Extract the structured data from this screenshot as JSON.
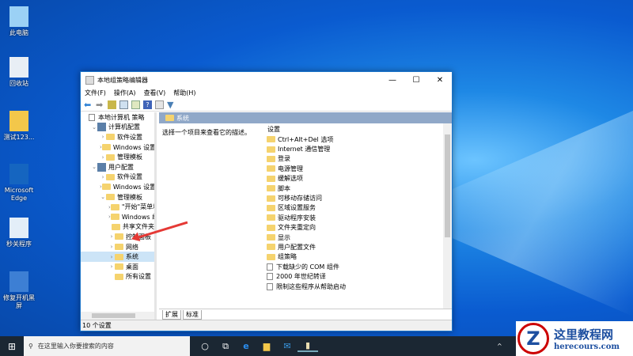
{
  "desktop": {
    "icons": [
      "此电脑",
      "回收站",
      "测试123...",
      "Microsoft Edge",
      "秒关程序",
      "修复开机黑屏"
    ]
  },
  "window": {
    "title": "本地组策略编辑器",
    "controls": [
      "—",
      "☐",
      "✕"
    ],
    "menu": [
      "文件(F)",
      "操作(A)",
      "查看(V)",
      "帮助(H)"
    ],
    "tree": [
      {
        "label": "本地计算机 策略",
        "level": 0,
        "chev": ""
      },
      {
        "label": "计算机配置",
        "level": 1,
        "chev": "⌄"
      },
      {
        "label": "软件设置",
        "level": 2,
        "chev": "›"
      },
      {
        "label": "Windows 设置",
        "level": 2,
        "chev": "›"
      },
      {
        "label": "管理模板",
        "level": 2,
        "chev": "›"
      },
      {
        "label": "用户配置",
        "level": 1,
        "chev": "⌄"
      },
      {
        "label": "软件设置",
        "level": 2,
        "chev": "›"
      },
      {
        "label": "Windows 设置",
        "level": 2,
        "chev": "›"
      },
      {
        "label": "管理模板",
        "level": 2,
        "chev": "⌄"
      },
      {
        "label": "\"开始\"菜单和",
        "level": 3,
        "chev": "›"
      },
      {
        "label": "Windows 组",
        "level": 3,
        "chev": "›"
      },
      {
        "label": "共享文件夹",
        "level": 3,
        "chev": ""
      },
      {
        "label": "控制面板",
        "level": 3,
        "chev": "›"
      },
      {
        "label": "网络",
        "level": 3,
        "chev": "›"
      },
      {
        "label": "系统",
        "level": 3,
        "chev": "›",
        "selected": true
      },
      {
        "label": "桌面",
        "level": 3,
        "chev": "›"
      },
      {
        "label": "所有设置",
        "level": 3,
        "chev": ""
      }
    ],
    "header": "系统",
    "description": "选择一个项目来查看它的描述。",
    "column": "设置",
    "folders": [
      "Ctrl+Alt+Del 选项",
      "Internet 通信管理",
      "登录",
      "电源管理",
      "缓解选项",
      "脚本",
      "可移动存储访问",
      "区域设置服务",
      "驱动程序安装",
      "文件夹重定向",
      "显示",
      "用户配置文件",
      "组策略"
    ],
    "policies": [
      "下载缺少的 COM 组件",
      "2000 年世纪转译",
      "限制这些程序从帮助启动"
    ],
    "tabs": [
      "扩展",
      "标准"
    ],
    "status": "10 个设置"
  },
  "taskbar": {
    "search_placeholder": "在这里输入你要搜索的内容"
  },
  "watermark": {
    "name": "这里教程网",
    "url": "herecours.com"
  }
}
